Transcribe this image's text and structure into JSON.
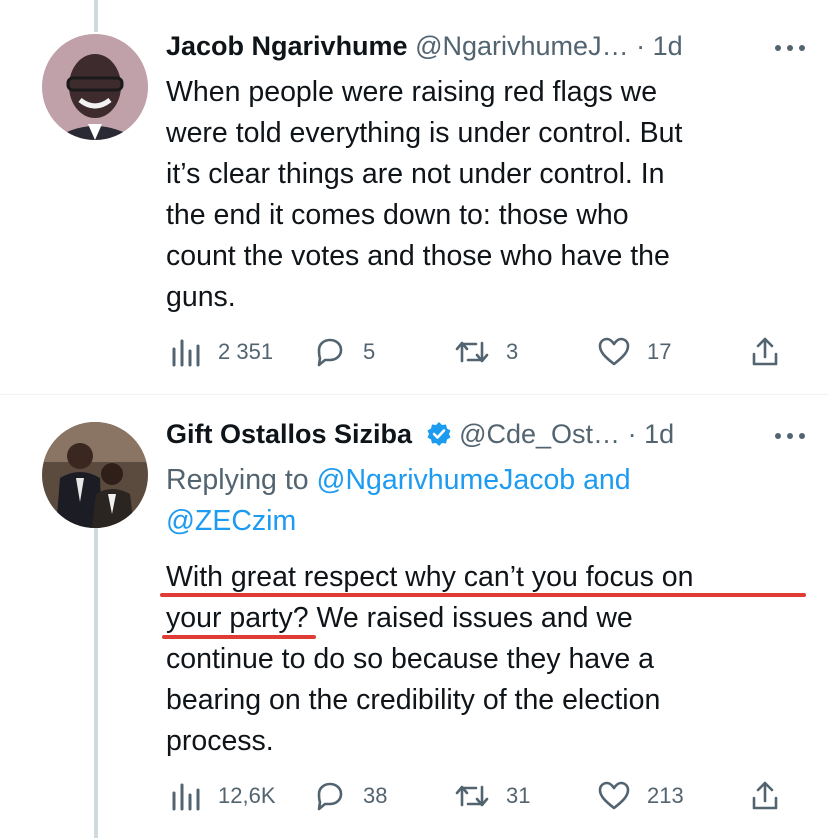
{
  "tweets": [
    {
      "author_name": "Jacob Ngarivhume",
      "author_handle": "@NgarivhumeJ…",
      "dot": "·",
      "time": "1d",
      "text_lines": [
        "When people were raising red flags we",
        "were told everything is under control. But",
        "it’s clear things are not under control. In",
        "the end it comes down to: those who",
        "count the votes and those who have the",
        "guns."
      ],
      "stats": {
        "views": "2 351",
        "replies": "5",
        "retweets": "3",
        "likes": "17"
      }
    },
    {
      "author_name": "Gift Ostallos Siziba",
      "author_handle": "@Cde_Ost…",
      "dot": "·",
      "time": "1d",
      "replying_prefix": "Replying to ",
      "replying_mention_1": "@NgarivhumeJacob",
      "replying_and": " and",
      "replying_mention_2": "@ZECzim",
      "text_lines": [
        "With great respect why can’t you focus on",
        "your party? We raised issues and we",
        "continue to do so because they have a",
        "bearing on the credibility of the election",
        "process."
      ],
      "stats": {
        "views": "12,6K",
        "replies": "38",
        "retweets": "31",
        "likes": "213"
      }
    }
  ],
  "colors": {
    "text": "#0f1419",
    "secondary": "#536471",
    "link": "#1d9bf0",
    "verified": "#1d9bf0",
    "annotation_underline": "#e03b34"
  },
  "icons": [
    "views-icon",
    "reply-icon",
    "retweet-icon",
    "like-icon",
    "share-icon",
    "more-icon",
    "verified-badge-icon"
  ]
}
